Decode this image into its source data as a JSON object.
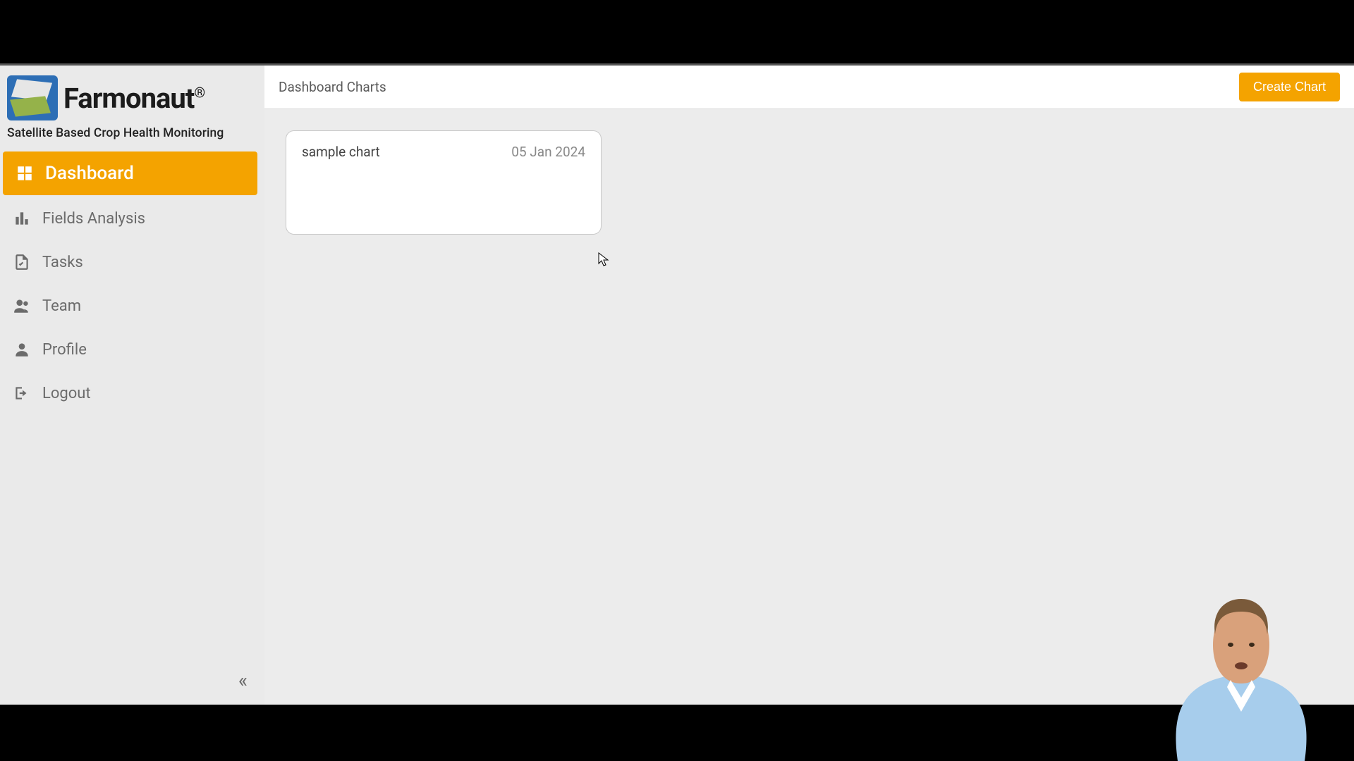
{
  "brand": {
    "name": "Farmonaut",
    "registered": "®",
    "tagline": "Satellite Based Crop Health Monitoring"
  },
  "sidebar": {
    "items": [
      {
        "label": "Dashboard"
      },
      {
        "label": "Fields Analysis"
      },
      {
        "label": "Tasks"
      },
      {
        "label": "Team"
      },
      {
        "label": "Profile"
      },
      {
        "label": "Logout"
      }
    ],
    "collapse_glyph": "«"
  },
  "header": {
    "title": "Dashboard Charts",
    "create_label": "Create Chart"
  },
  "charts": [
    {
      "name": "sample chart",
      "date": "05 Jan 2024"
    }
  ]
}
